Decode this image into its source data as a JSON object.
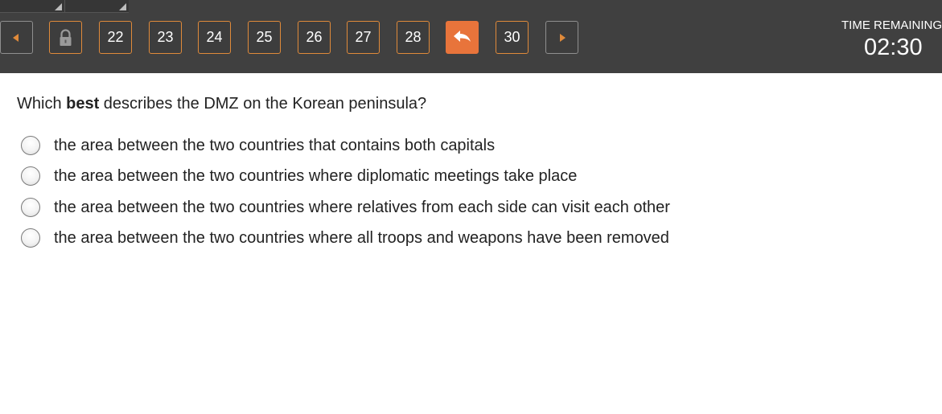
{
  "toolbar": {
    "previous_icon": "chevron-left-icon",
    "lock_icon": "lock-icon",
    "question_numbers": [
      "22",
      "23",
      "24",
      "25",
      "26",
      "27",
      "28"
    ],
    "current_icon": "return-arrow-icon",
    "next_number": "30",
    "next_icon": "chevron-right-icon",
    "accent_color": "#e8743b"
  },
  "timer": {
    "label": "TIME REMAINING",
    "value": "02:30"
  },
  "question": {
    "prefix": "Which ",
    "emphasis": "best",
    "suffix": " describes the DMZ on the Korean peninsula?"
  },
  "options": [
    "the area between the two countries that contains both capitals",
    "the area between the two countries where diplomatic meetings take place",
    "the area between the two countries where relatives from each side can visit each other",
    "the area between the two countries where all troops and weapons have been removed"
  ]
}
